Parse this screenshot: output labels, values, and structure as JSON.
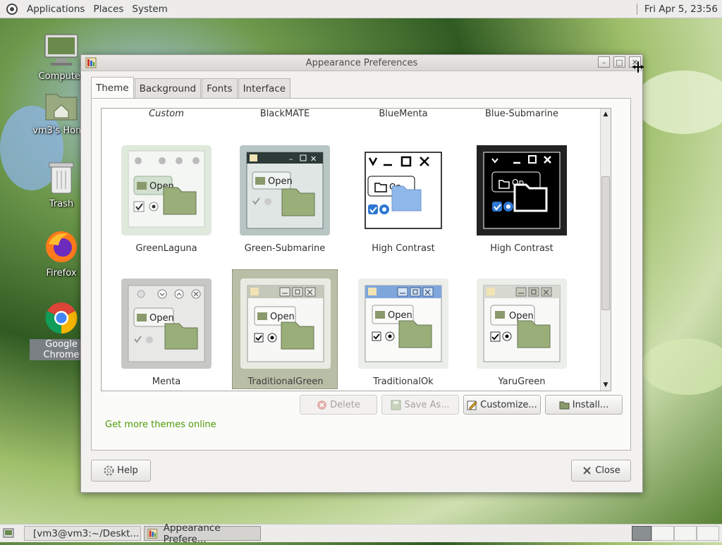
{
  "top_panel": {
    "menus": [
      "Applications",
      "Places",
      "System"
    ],
    "clock": "Fri Apr  5, 23:56"
  },
  "desktop_icons": [
    {
      "label": "Computer"
    },
    {
      "label": "vm3's Home"
    },
    {
      "label": "Trash"
    },
    {
      "label": "Firefox"
    },
    {
      "label": "Google Chrome"
    }
  ],
  "window": {
    "title": "Appearance Preferences",
    "tabs": [
      "Theme",
      "Background",
      "Fonts",
      "Interface"
    ],
    "active_tab": "Theme",
    "partial_row": [
      "Custom",
      "BlackMATE",
      "BlueMenta",
      "Blue-Submarine"
    ],
    "themes": [
      {
        "name": "GreenLaguna"
      },
      {
        "name": "Green-Submarine"
      },
      {
        "name": "High Contrast"
      },
      {
        "name": "High Contrast"
      },
      {
        "name": "Menta"
      },
      {
        "name": "TraditionalGreen",
        "selected": true
      },
      {
        "name": "TraditionalOk"
      },
      {
        "name": "YaruGreen"
      }
    ],
    "open_label": "Open",
    "buttons": {
      "delete": "Delete",
      "save_as": "Save As...",
      "customize": "Customize...",
      "install": "Install..."
    },
    "link": "Get more themes online",
    "help": "Help",
    "close": "Close"
  },
  "taskbar": {
    "tasks": [
      "[vm3@vm3:~/Deskt...",
      "Appearance Prefere..."
    ]
  },
  "colors": {
    "panel_bg": "#edeceb",
    "link_green": "#4e9a06",
    "selection": "#b9bea6"
  }
}
